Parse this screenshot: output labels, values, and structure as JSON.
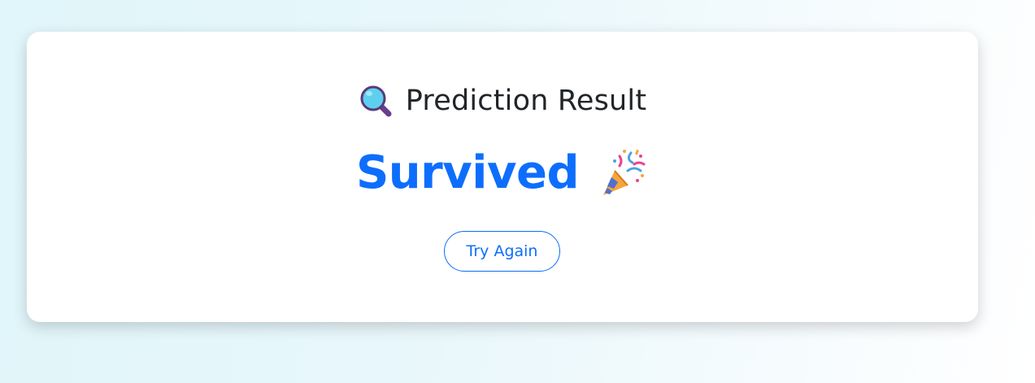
{
  "card": {
    "title": "Prediction Result",
    "title_icon": "magnifying-glass-icon",
    "result": "Survived",
    "result_icon": "party-popper-icon",
    "result_color": "#0d6efd",
    "button_label": "Try Again",
    "button_color": "#0d6efd"
  }
}
